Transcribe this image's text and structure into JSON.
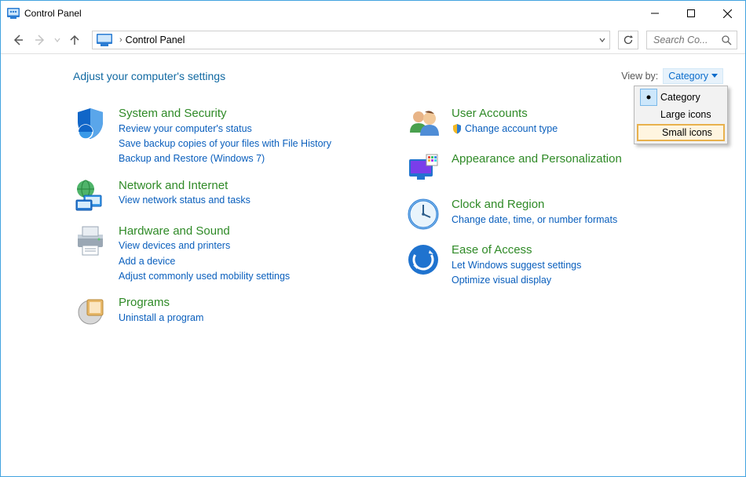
{
  "window": {
    "title": "Control Panel"
  },
  "address": {
    "text": "Control Panel"
  },
  "search": {
    "placeholder": "Search Co..."
  },
  "heading": "Adjust your computer's settings",
  "viewby": {
    "label": "View by:",
    "current": "Category",
    "options": [
      "Category",
      "Large icons",
      "Small icons"
    ],
    "selected_index": 0,
    "highlighted_index": 2
  },
  "left": {
    "system": {
      "title": "System and Security",
      "links": [
        "Review your computer's status",
        "Save backup copies of your files with File History",
        "Backup and Restore (Windows 7)"
      ]
    },
    "network": {
      "title": "Network and Internet",
      "links": [
        "View network status and tasks"
      ]
    },
    "hardware": {
      "title": "Hardware and Sound",
      "links": [
        "View devices and printers",
        "Add a device",
        "Adjust commonly used mobility settings"
      ]
    },
    "programs": {
      "title": "Programs",
      "links": [
        "Uninstall a program"
      ]
    }
  },
  "right": {
    "user": {
      "title": "User Accounts",
      "links": [
        "Change account type"
      ],
      "shielded": [
        0
      ]
    },
    "appearance": {
      "title": "Appearance and Personalization",
      "links": []
    },
    "clock": {
      "title": "Clock and Region",
      "links": [
        "Change date, time, or number formats"
      ]
    },
    "ease": {
      "title": "Ease of Access",
      "links": [
        "Let Windows suggest settings",
        "Optimize visual display"
      ]
    }
  }
}
